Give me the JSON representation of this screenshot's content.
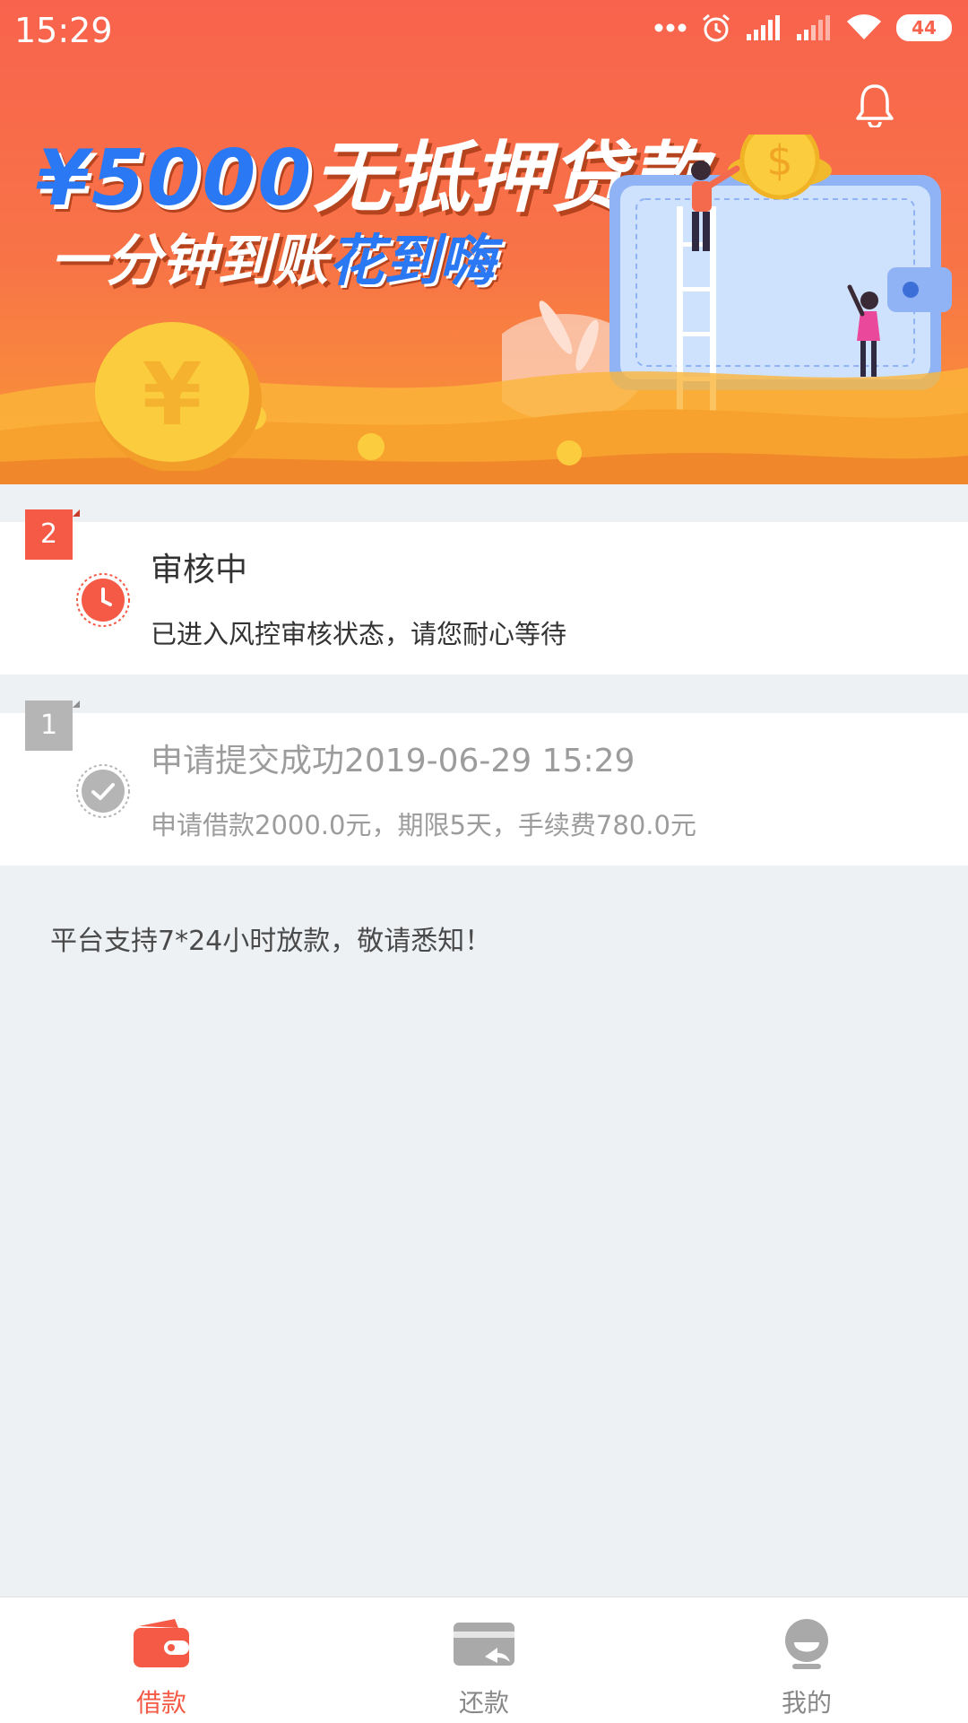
{
  "status_bar": {
    "time": "15:29",
    "icons": [
      "more-dots-icon",
      "alarm-icon",
      "signal-icon",
      "signal-icon",
      "wifi-icon",
      "battery-icon"
    ],
    "battery": "44"
  },
  "banner": {
    "headline_amount": "¥5000",
    "headline_text": "无抵押贷款",
    "subline_text": "一分钟到账",
    "subline_highlight": "花到嗨",
    "coin_symbol": "$",
    "big_coin_symbol": "¥"
  },
  "steps": [
    {
      "number": "2",
      "title": "审核中",
      "description": "已进入风控审核状态，请您耐心等待",
      "icon": "clock-icon",
      "state": "active"
    },
    {
      "number": "1",
      "title": "申请提交成功2019-06-29 15:29",
      "description": "申请借款2000.0元，期限5天，手续费780.0元",
      "icon": "check-icon",
      "state": "done"
    }
  ],
  "notice": "平台支持7*24小时放款，敬请悉知！",
  "bottom_nav": [
    {
      "label": "借款",
      "icon": "wallet-icon",
      "active": true
    },
    {
      "label": "还款",
      "icon": "repay-card-icon",
      "active": false
    },
    {
      "label": "我的",
      "icon": "user-icon",
      "active": false
    }
  ],
  "colors": {
    "accent": "#f45a45",
    "banner_blue": "#2a78f4",
    "inactive": "#b5b5b5",
    "background": "#eef1f4"
  }
}
